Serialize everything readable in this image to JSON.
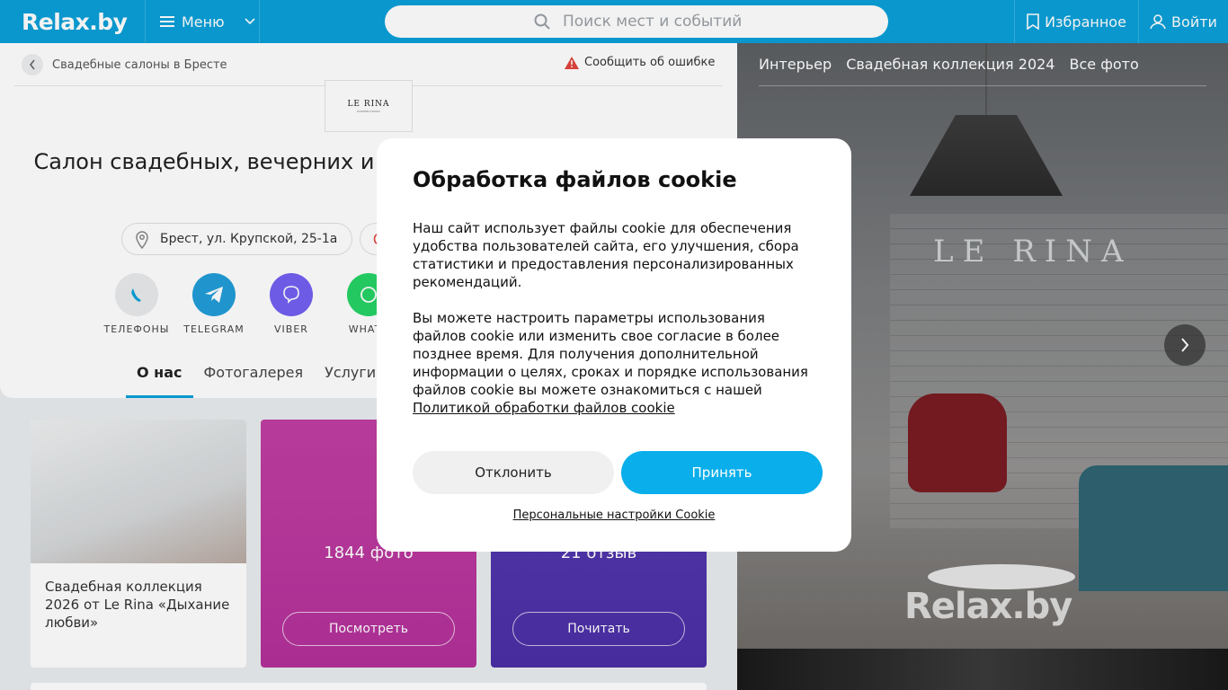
{
  "header": {
    "logo": "Relax.by",
    "menu_label": "Меню",
    "search_placeholder": "Поиск мест и событий",
    "favorites_label": "Избранное",
    "login_label": "Войти"
  },
  "breadcrumb": {
    "back_label": "Свадебные салоны в Бресте"
  },
  "report_label": "Сообщить об ошибке",
  "brand_logo": {
    "name": "LE RINA",
    "tagline": "FASHION STUDIO"
  },
  "page_title": "Салон свадебных, вечерних и выпускных платьев Ле Рина",
  "address": "Брест, ул. Крупской, 25-1а",
  "contacts": [
    {
      "label": "ТЕЛЕФОНЫ",
      "icon": "phone-icon",
      "color": "#e8eaec"
    },
    {
      "label": "TELEGRAM",
      "icon": "telegram-icon",
      "color": "#229ed9"
    },
    {
      "label": "VIBER",
      "icon": "viber-icon",
      "color": "#7360f2"
    },
    {
      "label": "WHATS",
      "icon": "whatsapp-icon",
      "color": "#25d366"
    }
  ],
  "tabs": [
    "О нас",
    "Фотогалерея",
    "Услуги"
  ],
  "tiles": {
    "collection_caption": "Свадебная коллекция 2026 от Le Rina «Дыхание любви»",
    "photos_count": "1844 фото",
    "photos_button": "Посмотреть",
    "reviews_count": "21 отзыв",
    "reviews_button": "Почитать"
  },
  "gallery": {
    "tabs": [
      "Интерьер",
      "Свадебная коллекция 2024",
      "Все фото"
    ],
    "sign": "LE RINA",
    "watermark": "Relax.by"
  },
  "cookie_modal": {
    "title": "Обработка файлов cookie",
    "paragraph1": "Наш сайт использует файлы cookie для обеспечения удобства пользователей сайта, его улучшения, сбора статистики и предоставления персонализированных рекомендаций.",
    "paragraph2": "Вы можете настроить параметры использования файлов cookie или изменить свое согласие в более позднее время. Для получения дополнительной информации о целях, сроках и порядке использования файлов cookie вы можете ознакомиться с нашей",
    "policy_link": "Политикой обработки файлов cookie",
    "decline_label": "Отклонить",
    "accept_label": "Принять",
    "personal_settings_label": "Персональные настройки Cookie"
  },
  "colors": {
    "brand": "#0aa0d8",
    "accent_button": "#0aaeea",
    "pink_tile": "#b4319a",
    "blue_tile": "#4a2fa6"
  }
}
